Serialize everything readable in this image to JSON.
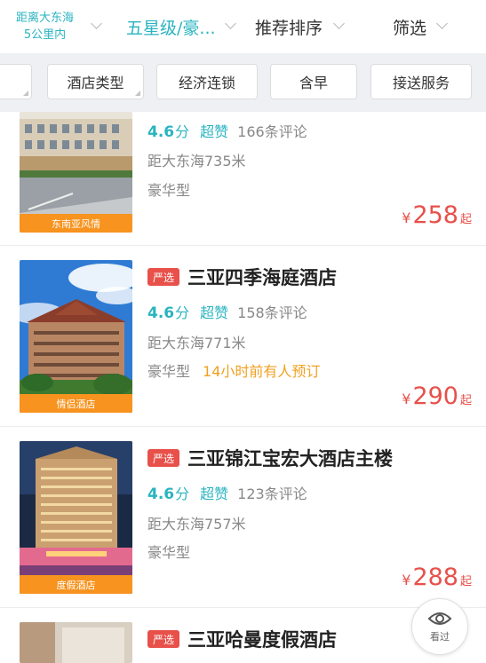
{
  "topbar": {
    "location_line1": "距离大东海",
    "location_line2": "5公里内",
    "star_filter": "五星级/豪...",
    "sort": "推荐排序",
    "filter": "筛选"
  },
  "chips": [
    {
      "label": "酒店类型"
    },
    {
      "label": "经济连锁"
    },
    {
      "label": "含早"
    },
    {
      "label": "接送服务"
    }
  ],
  "hotels": [
    {
      "badge": "",
      "name": "",
      "score": "4.6",
      "score_unit": "分",
      "praise": "超赞",
      "reviews": "166条评论",
      "distance": "距大东海735米",
      "level": "豪华型",
      "booked": "",
      "currency": "¥",
      "price": "258",
      "price_suffix": "起",
      "tag": "东南亚风情"
    },
    {
      "badge": "严选",
      "name": "三亚四季海庭酒店",
      "score": "4.6",
      "score_unit": "分",
      "praise": "超赞",
      "reviews": "158条评论",
      "distance": "距大东海771米",
      "level": "豪华型",
      "booked": "14小时前有人预订",
      "currency": "¥",
      "price": "290",
      "price_suffix": "起",
      "tag": "情侣酒店"
    },
    {
      "badge": "严选",
      "name": "三亚锦江宝宏大酒店主楼",
      "score": "4.6",
      "score_unit": "分",
      "praise": "超赞",
      "reviews": "123条评论",
      "distance": "距大东海757米",
      "level": "豪华型",
      "booked": "",
      "currency": "¥",
      "price": "288",
      "price_suffix": "起",
      "tag": "度假酒店"
    },
    {
      "badge": "严选",
      "name": "三亚哈曼度假酒店"
    }
  ],
  "viewed_button": {
    "label": "看过",
    "icon": "eye-icon"
  },
  "colors": {
    "accent": "#2ab4c0",
    "price": "#e8504a",
    "tag_bg": "#f7931e",
    "badge": "#e8504a"
  }
}
